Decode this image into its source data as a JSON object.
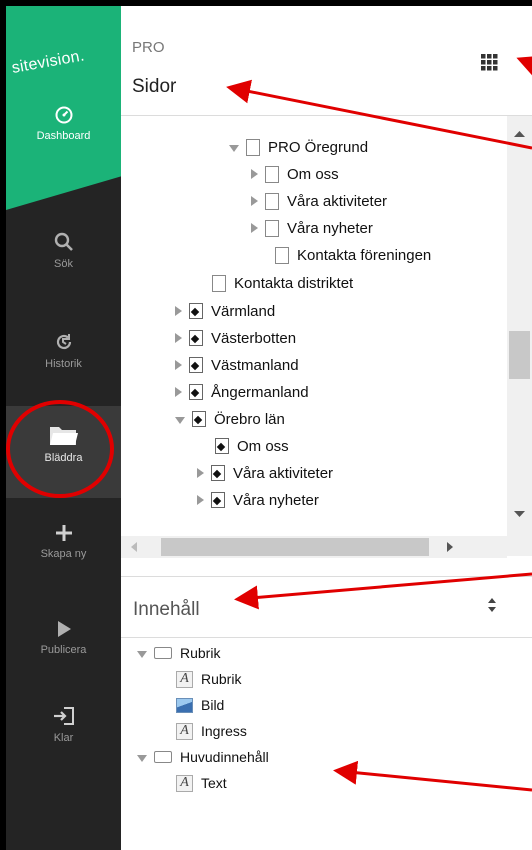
{
  "sidebar": {
    "logo": "sitevision.",
    "items": [
      {
        "label": "Dashboard",
        "icon": "dashboard-icon"
      },
      {
        "label": "Sök",
        "icon": "search-icon"
      },
      {
        "label": "Historik",
        "icon": "history-icon"
      },
      {
        "label": "Bläddra",
        "icon": "folder-icon"
      },
      {
        "label": "Skapa ny",
        "icon": "plus-icon"
      },
      {
        "label": "Publicera",
        "icon": "play-icon"
      },
      {
        "label": "Klar",
        "icon": "exit-icon"
      }
    ]
  },
  "header": {
    "context": "PRO",
    "title": "Sidor",
    "menu_icon": "grid-icon"
  },
  "tree": [
    {
      "label": "PRO Öregrund",
      "type": "page",
      "state": "expanded"
    },
    {
      "label": "Om oss",
      "type": "page",
      "state": "collapsed"
    },
    {
      "label": "Våra aktiviteter",
      "type": "page",
      "state": "collapsed"
    },
    {
      "label": "Våra nyheter",
      "type": "page",
      "state": "collapsed"
    },
    {
      "label": "Kontakta föreningen",
      "type": "page",
      "state": "leaf"
    },
    {
      "label": "Kontakta distriktet",
      "type": "page",
      "state": "leaf"
    },
    {
      "label": "Värmland",
      "type": "website",
      "state": "collapsed"
    },
    {
      "label": "Västerbotten",
      "type": "website",
      "state": "collapsed"
    },
    {
      "label": "Västmanland",
      "type": "website",
      "state": "collapsed"
    },
    {
      "label": "Ångermanland",
      "type": "website",
      "state": "collapsed"
    },
    {
      "label": "Örebro län",
      "type": "website",
      "state": "expanded"
    },
    {
      "label": "Om oss",
      "type": "website",
      "state": "leaf"
    },
    {
      "label": "Våra aktiviteter",
      "type": "website",
      "state": "collapsed"
    },
    {
      "label": "Våra nyheter",
      "type": "website",
      "state": "collapsed"
    }
  ],
  "content_panel": {
    "label": "Innehåll",
    "items": [
      {
        "label": "Rubrik",
        "type": "container",
        "state": "expanded"
      },
      {
        "label": "Rubrik",
        "type": "text"
      },
      {
        "label": "Bild",
        "type": "image"
      },
      {
        "label": "Ingress",
        "type": "text"
      },
      {
        "label": "Huvudinnehåll",
        "type": "container",
        "state": "expanded"
      },
      {
        "label": "Text",
        "type": "text"
      }
    ]
  },
  "colors": {
    "brand": "#1bb378",
    "sidebar": "#242424",
    "annotation": "#e00000"
  }
}
